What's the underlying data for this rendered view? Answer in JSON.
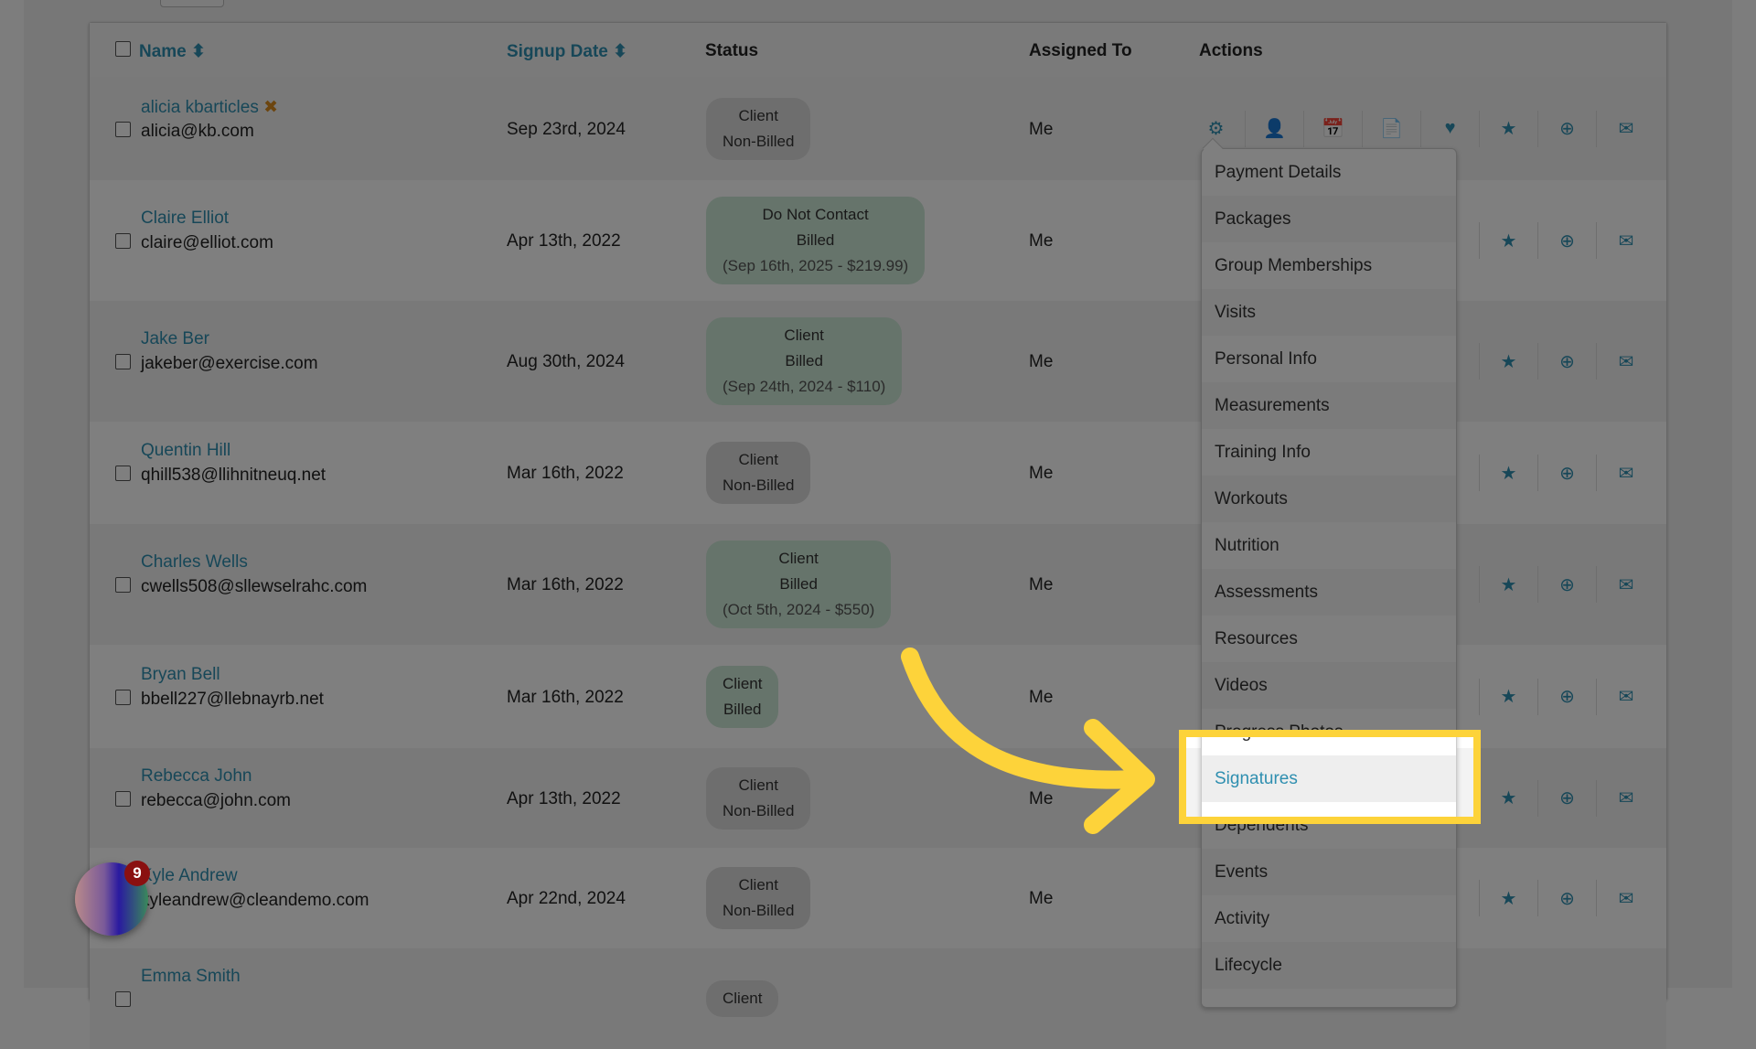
{
  "table": {
    "headers": {
      "name": "Name",
      "signup": "Signup Date",
      "status": "Status",
      "assigned": "Assigned To",
      "actions": "Actions"
    },
    "rows": [
      {
        "name": "alicia kbarticles",
        "email": "alicia@kb.com",
        "date": "Sep 23rd, 2024",
        "status": [
          "Client",
          "Non-Billed"
        ],
        "status_color": "gray",
        "assigned": "Me",
        "flag": "✖"
      },
      {
        "name": "Claire Elliot",
        "email": "claire@elliot.com",
        "date": "Apr 13th, 2022",
        "status": [
          "Do Not Contact",
          "Billed",
          "(Sep 16th, 2025 - $219.99)"
        ],
        "status_color": "green",
        "assigned": "Me"
      },
      {
        "name": "Jake Ber",
        "email": "jakeber@exercise.com",
        "date": "Aug 30th, 2024",
        "status": [
          "Client",
          "Billed",
          "(Sep 24th, 2024 - $110)"
        ],
        "status_color": "green",
        "assigned": "Me"
      },
      {
        "name": "Quentin Hill",
        "email": "qhill538@llihnitneuq.net",
        "date": "Mar 16th, 2022",
        "status": [
          "Client",
          "Non-Billed"
        ],
        "status_color": "gray",
        "assigned": "Me"
      },
      {
        "name": "Charles Wells",
        "email": "cwells508@sllewselrahc.com",
        "date": "Mar 16th, 2022",
        "status": [
          "Client",
          "Billed",
          "(Oct 5th, 2024 - $550)"
        ],
        "status_color": "green",
        "assigned": "Me"
      },
      {
        "name": "Bryan Bell",
        "email": "bbell227@llebnayrb.net",
        "date": "Mar 16th, 2022",
        "status": [
          "Client",
          "Billed"
        ],
        "status_color": "green",
        "assigned": "Me"
      },
      {
        "name": "Rebecca John",
        "email": "rebecca@john.com",
        "date": "Apr 13th, 2022",
        "status": [
          "Client",
          "Non-Billed"
        ],
        "status_color": "gray",
        "assigned": "Me"
      },
      {
        "name": "Kyle Andrew",
        "email": "kyleandrew@cleandemo.com",
        "date": "Apr 22nd, 2024",
        "status": [
          "Client",
          "Non-Billed"
        ],
        "status_color": "gray",
        "assigned": "Me"
      },
      {
        "name": "Emma Smith",
        "email": "",
        "date": "",
        "status": [
          "Client"
        ],
        "status_color": "gray",
        "assigned": ""
      }
    ],
    "action_icons": [
      "gear-icon",
      "user-icon",
      "calendar-check-icon",
      "document-icon",
      "heartbeat-icon",
      "star-icon",
      "plus-circle-icon",
      "envelope-icon"
    ]
  },
  "dropdown": {
    "items": [
      "Payment Details",
      "Packages",
      "Group Memberships",
      "Visits",
      "Personal Info",
      "Measurements",
      "Training Info",
      "Workouts",
      "Nutrition",
      "Assessments",
      "Resources",
      "Videos",
      "Progress Photos",
      "Signatures",
      "Dependents",
      "Events",
      "Activity",
      "Lifecycle"
    ],
    "active": "Signatures"
  },
  "notification_badge": "9",
  "colors": {
    "accent": "#2f8fb0",
    "highlight": "#fdd33a",
    "flag": "#d98a1e"
  }
}
